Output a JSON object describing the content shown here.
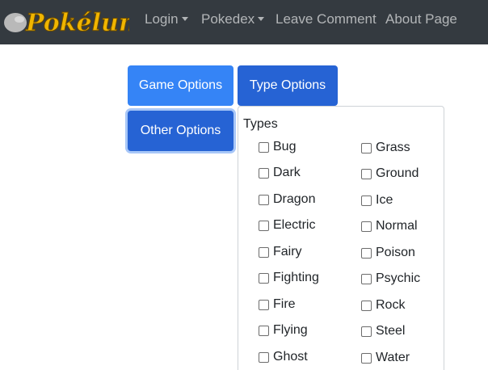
{
  "navbar": {
    "brand": "Pokéluna",
    "links": [
      {
        "label": "Login",
        "has_dropdown": true
      },
      {
        "label": "Pokedex",
        "has_dropdown": true
      },
      {
        "label": "Leave Comment",
        "has_dropdown": false
      },
      {
        "label": "About Page",
        "has_dropdown": false
      }
    ]
  },
  "buttons": {
    "game_options": "Game Options",
    "type_options": "Type Options",
    "other_options": "Other Options"
  },
  "types_menu": {
    "header": "Types",
    "left_column": [
      "Bug",
      "Dark",
      "Dragon",
      "Electric",
      "Fairy",
      "Fighting",
      "Fire",
      "Flying",
      "Ghost"
    ],
    "right_column": [
      "Grass",
      "Ground",
      "Ice",
      "Normal",
      "Poison",
      "Psychic",
      "Rock",
      "Steel",
      "Water"
    ]
  },
  "colors": {
    "navbar_bg": "#343a40",
    "primary": "#3584f6",
    "primary_active": "#2663d4"
  }
}
